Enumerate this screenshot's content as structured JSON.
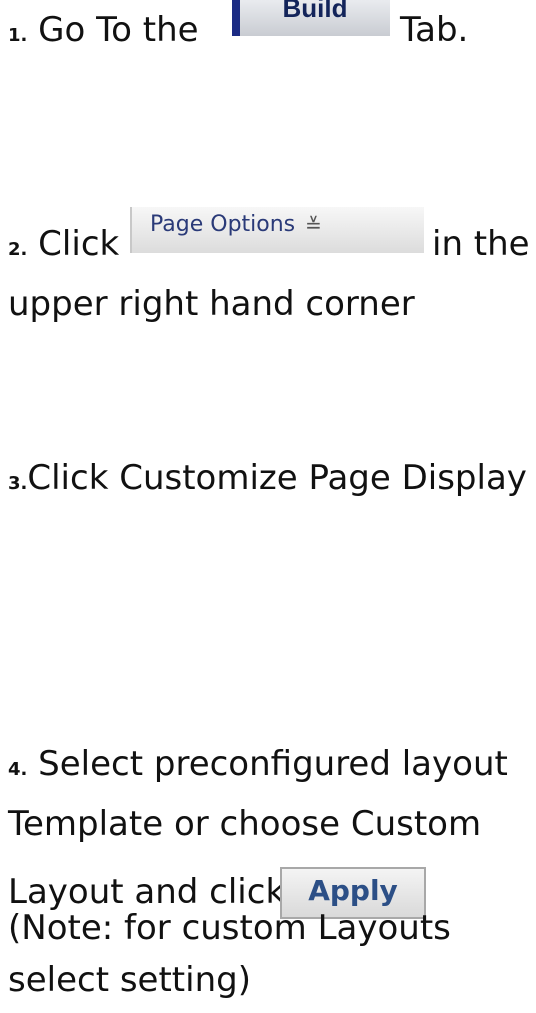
{
  "step1": {
    "num": "1.",
    "pre": " Go To the",
    "button": "Build",
    "post": "Tab."
  },
  "step2": {
    "num": "2.",
    "pre": " Click",
    "button": "Page Options",
    "chevron_icon": "chevron-down-double-icon",
    "post": "in the",
    "line2": "upper right hand corner"
  },
  "step3": {
    "num": "3.",
    "text": "Click Customize Page Display"
  },
  "step4": {
    "num": "4.",
    "line1": " Select preconfigured layout",
    "line2": "Template or choose Custom",
    "line3": "Layout and click",
    "button": "Apply",
    "line4": "(Note: for custom Layouts",
    "line5": "select setting)"
  },
  "colors": {
    "build_border": "#1b2b84",
    "build_text": "#13245a",
    "page_options_text": "#2a3a78",
    "apply_text": "#2c4f86"
  }
}
